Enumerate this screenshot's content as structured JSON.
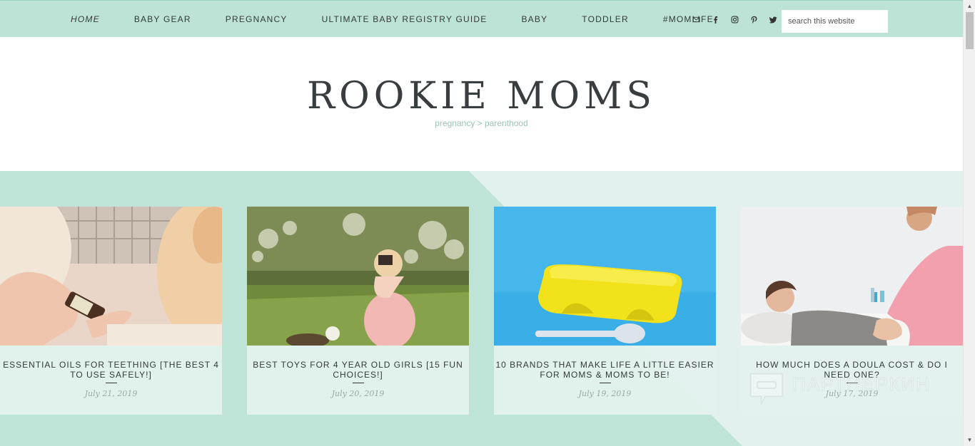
{
  "nav": {
    "items": [
      {
        "label": "HOME",
        "active": true
      },
      {
        "label": "BABY GEAR",
        "active": false
      },
      {
        "label": "PREGNANCY",
        "active": false
      },
      {
        "label": "ULTIMATE BABY REGISTRY GUIDE",
        "active": false
      },
      {
        "label": "BABY",
        "active": false
      },
      {
        "label": "TODDLER",
        "active": false
      },
      {
        "label": "#MOMLIFE",
        "active": false
      }
    ],
    "social_icons": [
      "email-icon",
      "facebook-icon",
      "instagram-icon",
      "pinterest-icon",
      "twitter-icon"
    ],
    "search_placeholder": "search this website"
  },
  "header": {
    "title": "ROOKIE MOMS",
    "tagline": "pregnancy > parenthood"
  },
  "featured": {
    "posts": [
      {
        "title": "ESSENTIAL OILS FOR TEETHING [THE BEST 4 TO USE SAFELY!]",
        "date": "July 21, 2019",
        "image": "essential-oils-photo"
      },
      {
        "title": "BEST TOYS FOR 4 YEAR OLD GIRLS [15 FUN CHOICES!]",
        "date": "July 20, 2019",
        "image": "girl-camera-photo"
      },
      {
        "title": "10 BRANDS THAT MAKE LIFE A LITTLE EASIER FOR MOMS & MOMS TO BE!",
        "date": "July 19, 2019",
        "image": "lunchbox-photo"
      },
      {
        "title": "HOW MUCH DOES A DOULA COST & DO I NEED ONE?",
        "date": "July 17, 2019",
        "image": "doula-photo"
      }
    ]
  },
  "watermark": {
    "text": "ПАРТНЕРКИН"
  },
  "colors": {
    "nav_bg": "#bce3d6",
    "band_bg": "#bee3d7",
    "band_light": "#e2f1ed",
    "title_text": "#383e40",
    "tagline": "#9cc3b7"
  }
}
